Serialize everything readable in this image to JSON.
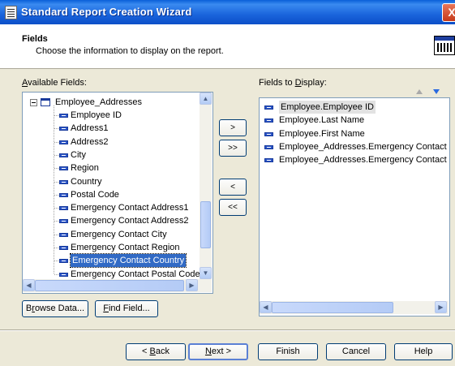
{
  "window": {
    "title": "Standard Report Creation Wizard",
    "close_glyph": "X"
  },
  "header": {
    "title": "Fields",
    "description": "Choose the information to display on the report."
  },
  "available": {
    "label_prefix": "",
    "label_mnemonic": "A",
    "label_rest": "vailable Fields:",
    "table": "Employee_Addresses",
    "fields": [
      "Employee ID",
      "Address1",
      "Address2",
      "City",
      "Region",
      "Country",
      "Postal Code",
      "Emergency Contact Address1",
      "Emergency Contact Address2",
      "Emergency Contact City",
      "Emergency Contact Region",
      "Emergency Contact Country",
      "Emergency Contact Postal Code"
    ],
    "selected_index": 11
  },
  "display": {
    "label_prefix": "Fields to ",
    "label_mnemonic": "D",
    "label_rest": "isplay:",
    "fields": [
      "Employee.Employee ID",
      "Employee.Last Name",
      "Employee.First Name",
      "Employee_Addresses.Emergency Contact C",
      "Employee_Addresses.Emergency Contact R"
    ],
    "highlighted_index": 0
  },
  "move_buttons": {
    "add": ">",
    "add_all": ">>",
    "remove": "<",
    "remove_all": "<<"
  },
  "browse": {
    "prefix": "B",
    "mnemonic": "r",
    "rest": "owse Data..."
  },
  "find": {
    "prefix": "",
    "mnemonic": "F",
    "rest": "ind Field..."
  },
  "footer": {
    "back": {
      "prefix": "< ",
      "mnemonic": "B",
      "rest": "ack"
    },
    "next": {
      "prefix": "",
      "mnemonic": "N",
      "rest": "ext >"
    },
    "finish": "Finish",
    "cancel": "Cancel",
    "help": "Help"
  },
  "scroll_glyphs": {
    "up": "▲",
    "down": "▼",
    "left": "◀",
    "right": "▶"
  },
  "icons": {
    "app": "report-wizard-icon",
    "header": "table-report-icon",
    "move_up": "arrow-up-icon",
    "move_down": "arrow-down-icon"
  }
}
